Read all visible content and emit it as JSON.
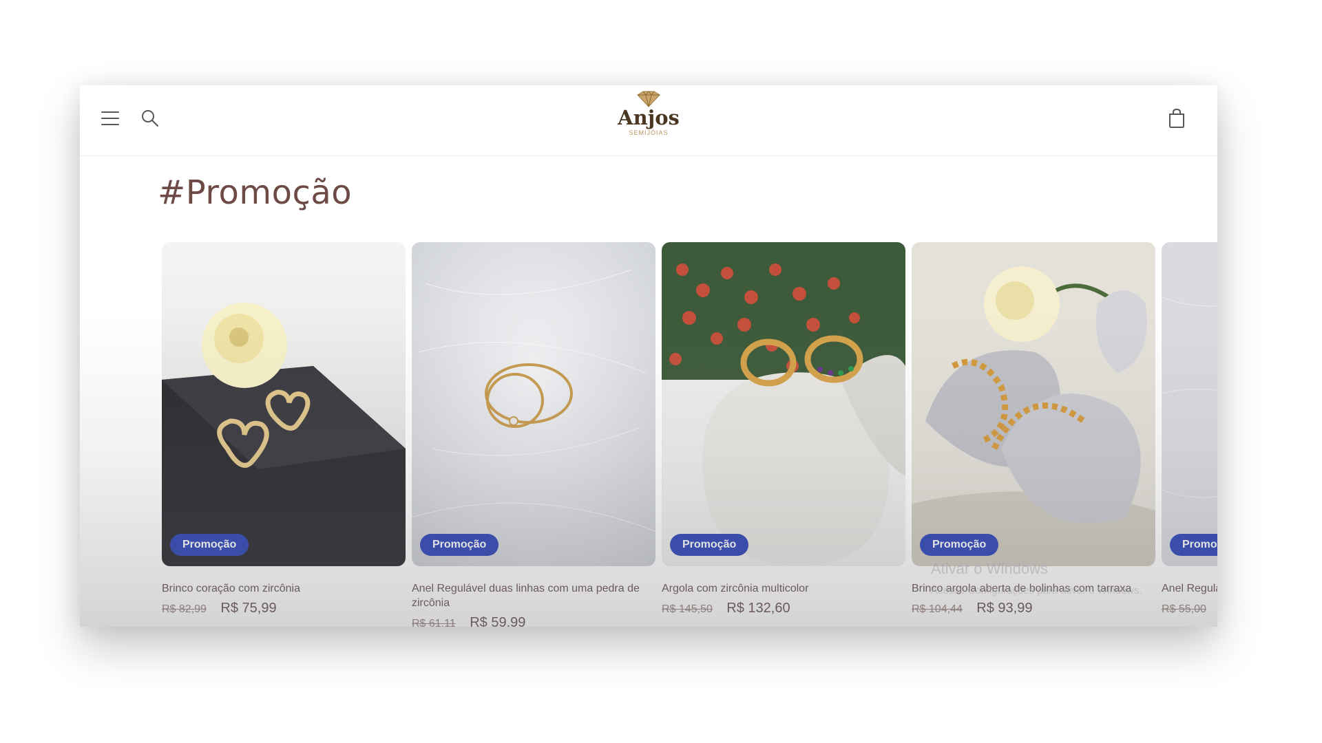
{
  "store": {
    "name": "Anjos",
    "tagline": "SEMIJÓIAS"
  },
  "header": {
    "menu_icon": "hamburger-icon",
    "search_icon": "search-icon",
    "cart_icon": "cart-icon"
  },
  "collection": {
    "title": "#Promoção"
  },
  "products": [
    {
      "badge": "Promoção",
      "title": "Brinco coração com zircônia",
      "old_price": "R$ 82,99",
      "price": "R$ 75,99"
    },
    {
      "badge": "Promoção",
      "title": "Anel Regulável duas linhas com uma pedra de zircônia",
      "old_price": "R$ 61,11",
      "price": "R$ 59,99"
    },
    {
      "badge": "Promoção",
      "title": "Argola com zircônia multicolor",
      "old_price": "R$ 145,50",
      "price": "R$ 132,60"
    },
    {
      "badge": "Promoção",
      "title": "Brinco argola aberta de bolinhas com tarraxa",
      "old_price": "R$ 104,44",
      "price": "R$ 93,99"
    },
    {
      "badge": "Promoção",
      "title": "Anel Regulável",
      "old_price": "R$ 55,00",
      "price": ""
    }
  ],
  "watermark": {
    "title": "Ativar o Windows",
    "subtitle": "Acesse Configurações para ativar o Windows."
  },
  "colors": {
    "badge": "#2f46b8",
    "heading": "#6d4a45",
    "brand_gold": "#b8955c"
  }
}
